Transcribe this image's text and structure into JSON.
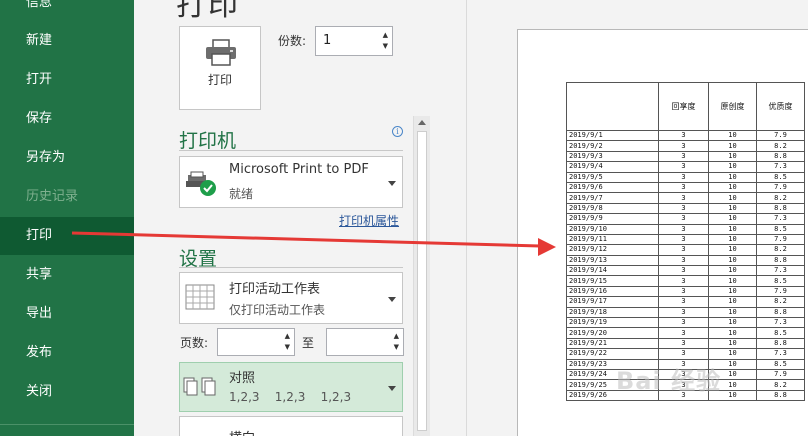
{
  "nav": {
    "items": [
      {
        "label": "信息"
      },
      {
        "label": "新建"
      },
      {
        "label": "打开"
      },
      {
        "label": "保存"
      },
      {
        "label": "另存为"
      },
      {
        "label": "历史记录"
      },
      {
        "label": "打印"
      },
      {
        "label": "共享"
      },
      {
        "label": "导出"
      },
      {
        "label": "发布"
      },
      {
        "label": "关闭"
      }
    ]
  },
  "page_title": "打印",
  "print_button_label": "打印",
  "copies": {
    "label": "份数:",
    "value": "1"
  },
  "printer": {
    "heading": "打印机",
    "name": "Microsoft Print to PDF",
    "status": "就绪",
    "properties_link": "打印机属性"
  },
  "settings": {
    "heading": "设置",
    "scope": {
      "title": "打印活动工作表",
      "subtitle": "仅打印活动工作表"
    },
    "pages_label": "页数:",
    "to_label": "至",
    "collate": {
      "title": "对照",
      "subtitle": "1,2,3    1,2,3    1,2,3"
    },
    "partial_label": "横向"
  },
  "icons": {
    "printer": "printer-icon",
    "pdf_printer": "pdf-printer-check-icon",
    "sheet": "worksheet-grid-icon",
    "collate": "collate-pages-icon",
    "info": "info-icon"
  },
  "colors": {
    "accent": "#217346",
    "nav_active": "#0f5a32",
    "arrow": "#e53935"
  },
  "preview": {
    "headers": [
      "",
      "回享度",
      "原创度",
      "优质度"
    ],
    "rows": [
      [
        "2019/9/1",
        "3",
        "10",
        "7.9"
      ],
      [
        "2019/9/2",
        "3",
        "10",
        "8.2"
      ],
      [
        "2019/9/3",
        "3",
        "10",
        "8.8"
      ],
      [
        "2019/9/4",
        "3",
        "10",
        "7.3"
      ],
      [
        "2019/9/5",
        "3",
        "10",
        "8.5"
      ],
      [
        "2019/9/6",
        "3",
        "10",
        "7.9"
      ],
      [
        "2019/9/7",
        "3",
        "10",
        "8.2"
      ],
      [
        "2019/9/8",
        "3",
        "10",
        "8.8"
      ],
      [
        "2019/9/9",
        "3",
        "10",
        "7.3"
      ],
      [
        "2019/9/10",
        "3",
        "10",
        "8.5"
      ],
      [
        "2019/9/11",
        "3",
        "10",
        "7.9"
      ],
      [
        "2019/9/12",
        "3",
        "10",
        "8.2"
      ],
      [
        "2019/9/13",
        "3",
        "10",
        "8.8"
      ],
      [
        "2019/9/14",
        "3",
        "10",
        "7.3"
      ],
      [
        "2019/9/15",
        "3",
        "10",
        "8.5"
      ],
      [
        "2019/9/16",
        "3",
        "10",
        "7.9"
      ],
      [
        "2019/9/17",
        "3",
        "10",
        "8.2"
      ],
      [
        "2019/9/18",
        "3",
        "10",
        "8.8"
      ],
      [
        "2019/9/19",
        "3",
        "10",
        "7.3"
      ],
      [
        "2019/9/20",
        "3",
        "10",
        "8.5"
      ],
      [
        "2019/9/21",
        "3",
        "10",
        "8.8"
      ],
      [
        "2019/9/22",
        "3",
        "10",
        "7.3"
      ],
      [
        "2019/9/23",
        "3",
        "10",
        "8.5"
      ],
      [
        "2019/9/24",
        "3",
        "10",
        "7.9"
      ],
      [
        "2019/9/25",
        "3",
        "10",
        "8.2"
      ],
      [
        "2019/9/26",
        "3",
        "10",
        "8.8"
      ]
    ],
    "watermark": "Bai 经验"
  }
}
